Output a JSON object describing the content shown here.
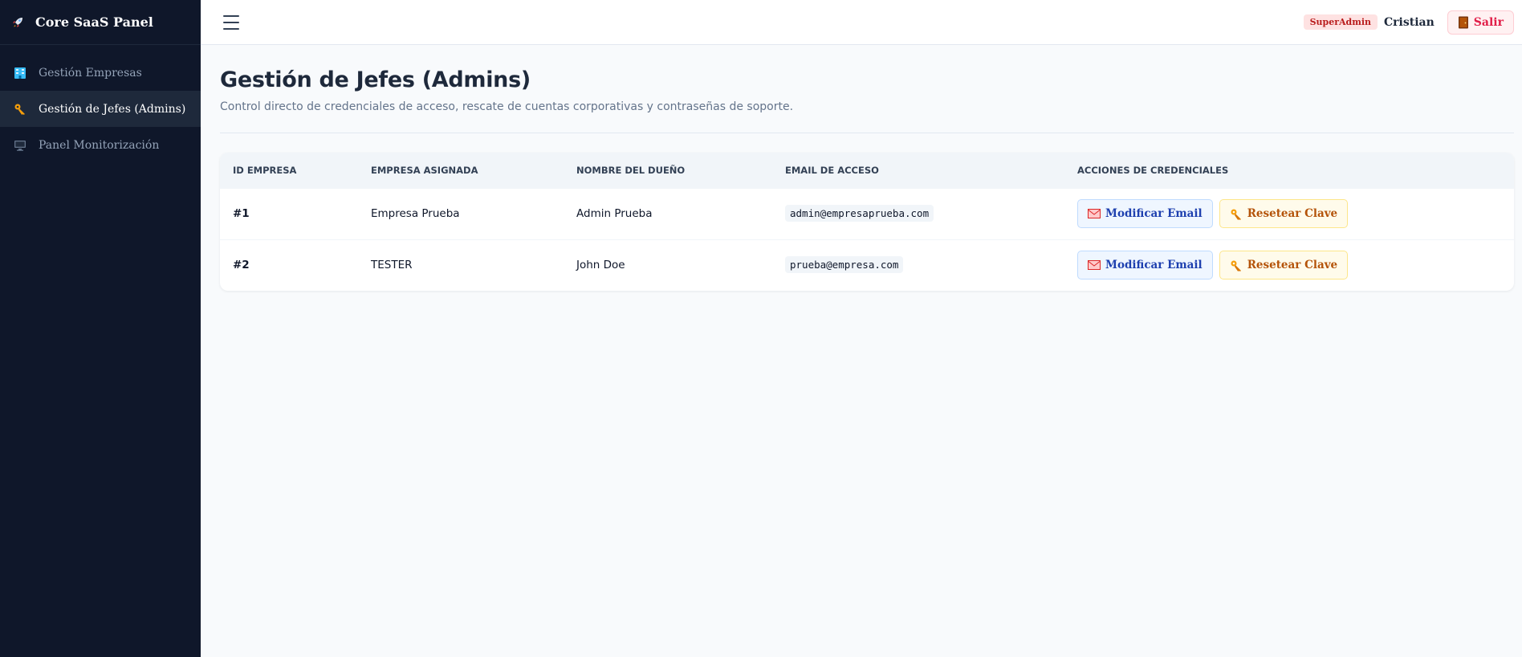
{
  "brand": {
    "icon": "rocket-icon",
    "title": "Core SaaS Panel"
  },
  "sidebar": {
    "items": [
      {
        "icon": "building-icon",
        "label": "Gestión Empresas",
        "active": false
      },
      {
        "icon": "key-icon",
        "label": "Gestión de Jefes (Admins)",
        "active": true
      },
      {
        "icon": "monitor-icon",
        "label": "Panel Monitorización",
        "active": false
      }
    ]
  },
  "topbar": {
    "menu_icon": "hamburger-icon",
    "role_badge": "SuperAdmin",
    "user_name": "Cristian",
    "logout_label": "Salir",
    "logout_icon": "door-icon"
  },
  "page": {
    "title": "Gestión de Jefes (Admins)",
    "subtitle": "Control directo de credenciales de acceso, rescate de cuentas corporativas y contraseñas de soporte."
  },
  "table": {
    "headers": [
      "ID Empresa",
      "Empresa Asignada",
      "Nombre del Dueño",
      "Email de Acceso",
      "Acciones de Credenciales"
    ],
    "rows": [
      {
        "id": "#1",
        "company": "Empresa Prueba",
        "owner": "Admin Prueba",
        "email": "admin@empresaprueba.com"
      },
      {
        "id": "#2",
        "company": "TESTER",
        "owner": "John Doe",
        "email": "prueba@empresa.com"
      }
    ],
    "actions": {
      "edit_email_label": "Modificar Email",
      "edit_email_icon": "envelope-icon",
      "reset_label": "Resetear Clave",
      "reset_icon": "key-icon"
    }
  },
  "colors": {
    "sidebar_bg": "#0f172a",
    "sidebar_active": "#1e293b",
    "accent_blue": "#1e40af",
    "accent_amber": "#b45309",
    "danger": "#e11d48"
  }
}
